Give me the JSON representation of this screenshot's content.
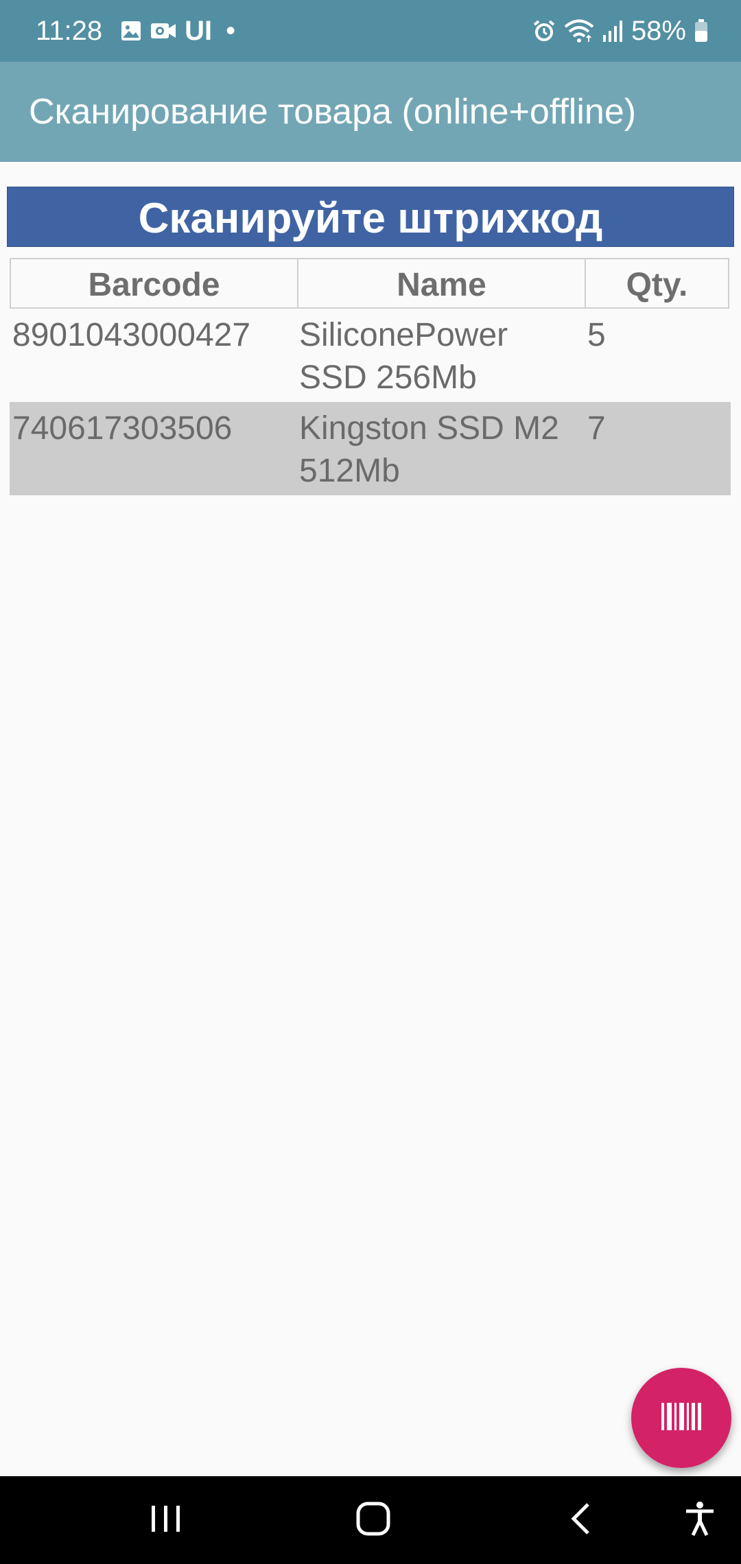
{
  "status_bar": {
    "time": "11:28",
    "carrier_label": "UI",
    "battery": "58%",
    "icons": [
      "gallery-icon",
      "camera-notification-icon",
      "alarm-icon",
      "wifi-icon",
      "signal-icon",
      "battery-icon"
    ]
  },
  "app_bar": {
    "title": "Сканирование товара (online+offline)"
  },
  "banner": {
    "text": "Сканируйте штрихкод",
    "color": "#4064a3"
  },
  "table": {
    "headers": [
      "Barcode",
      "Name",
      "Qty."
    ],
    "rows": [
      {
        "barcode": "8901043000427",
        "name_line1": "SiliconePower",
        "name_line2": "SSD 256Mb",
        "qty": "5"
      },
      {
        "barcode": "740617303506",
        "name_line1": "Kingston SSD M2",
        "name_line2": "512Mb",
        "qty": "7"
      }
    ]
  },
  "fab": {
    "icon": "barcode-icon",
    "color": "#d42266"
  },
  "nav_bar": {
    "icons": [
      "recents-icon",
      "home-icon",
      "back-icon",
      "accessibility-icon"
    ]
  },
  "colors": {
    "status_bar": "#528fa2",
    "app_bar": "#72a6b5",
    "row_highlight": "#cccccc"
  }
}
